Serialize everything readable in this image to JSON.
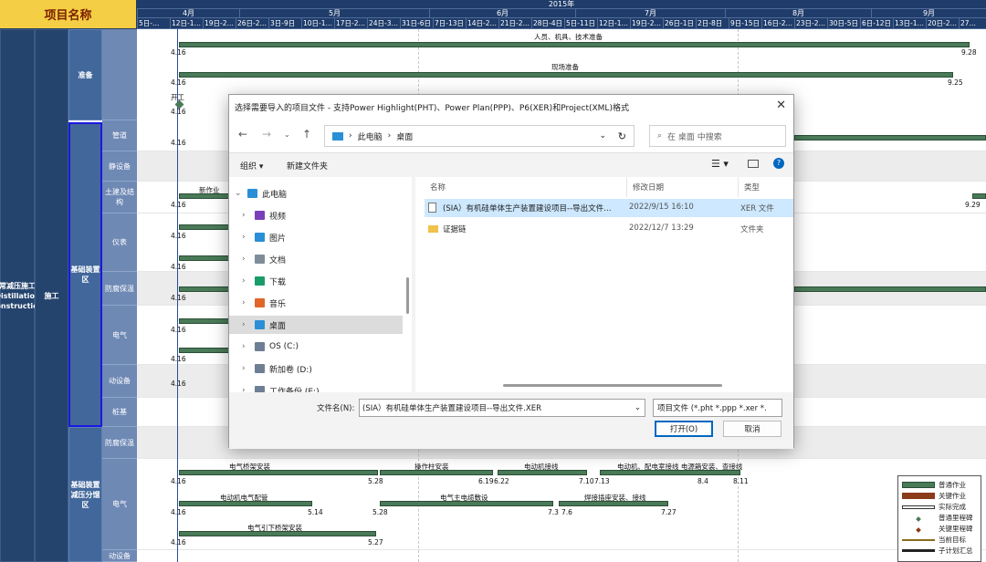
{
  "project_header": "项目名称",
  "timeline": {
    "year": "2015年",
    "months": [
      "4月",
      "5月",
      "6月",
      "7月",
      "8月",
      "9月"
    ],
    "weeks": [
      "5日-…",
      "12日-1…",
      "19日-2…",
      "26日-2…",
      "3日-9日",
      "10日-1…",
      "17日-2…",
      "24日-3…",
      "31日-6日",
      "7日-13日",
      "14日-2…",
      "21日-2…",
      "28日-4日",
      "5日-11日",
      "12日-1…",
      "19日-2…",
      "26日-1日",
      "2日-8日",
      "9日-15日",
      "16日-2…",
      "23日-2…",
      "30日-5日",
      "6日-12日",
      "13日-1…",
      "20日-2…",
      "27…"
    ]
  },
  "tree": {
    "level1": "常减压施工 Distillation construction",
    "level2": "施工",
    "groups": [
      {
        "label": "准备"
      },
      {
        "label": "基础装置区"
      },
      {
        "label": "基础装置减压分馏区"
      }
    ],
    "items": [
      "管道",
      "静设备",
      "土建及结构",
      "仪表",
      "防腐保温",
      "电气",
      "动设备",
      "桩基",
      "防腐保温",
      "电气",
      "动设备"
    ]
  },
  "gantt": {
    "labels": {
      "people": "人员、机具、技术准备",
      "site": "现场准备",
      "start": "开工",
      "newjob": "新作业",
      "cable_tray": "电气桥架安装",
      "column": "操作柱安装",
      "motor_wiring": "电动机接线",
      "motor_dist": "电动机、配电室接线 电源箱安装、查接线",
      "motor_cfg": "电动机电气配管",
      "main_cable": "电气主电缆敷设",
      "weld": "焊接插座安装、接线",
      "cable_lay": "电气引下桥架安装"
    },
    "dates": [
      "4.16",
      "9.28",
      "9.25",
      "9.29",
      "5.28",
      "6.19",
      "6.22",
      "7.10",
      "7.13",
      "8.4",
      "8.11",
      "5.14",
      "5.28",
      "7.3",
      "7.6",
      "7.27",
      "5.27"
    ]
  },
  "dialog": {
    "title": "选择需要导入的项目文件 - 支持Power Highlight(PHT)、Power Plan(PPP)、P6(XER)和Project(XML)格式",
    "breadcrumb": [
      "此电脑",
      "桌面"
    ],
    "search_placeholder": "在 桌面 中搜索",
    "organize": "组织 ▾",
    "new_folder": "新建文件夹",
    "tree": [
      {
        "label": "此电脑",
        "icon": "computer-icon",
        "expanded": true
      },
      {
        "label": "视频",
        "icon": "video-icon"
      },
      {
        "label": "图片",
        "icon": "picture-icon"
      },
      {
        "label": "文档",
        "icon": "document-icon"
      },
      {
        "label": "下载",
        "icon": "download-icon"
      },
      {
        "label": "音乐",
        "icon": "music-icon"
      },
      {
        "label": "桌面",
        "icon": "desktop-icon",
        "selected": true
      },
      {
        "label": "OS (C:)",
        "icon": "drive-icon"
      },
      {
        "label": "新加卷 (D:)",
        "icon": "drive-icon"
      },
      {
        "label": "工作备份 (E:)",
        "icon": "drive-icon"
      }
    ],
    "columns": [
      "名称",
      "修改日期",
      "类型"
    ],
    "files": [
      {
        "name": "(SIA）有机硅单体生产装置建设项目--导出文件…",
        "date": "2022/9/15 16:10",
        "type": "XER 文件",
        "selected": true
      },
      {
        "name": "证据链",
        "date": "2022/12/7 13:29",
        "type": "文件夹"
      }
    ],
    "filename_label": "文件名(N):",
    "filename_value": "(SIA）有机硅单体生产装置建设项目--导出文件.XER",
    "filetype_value": "项目文件 (*.pht *.ppp *.xer *.",
    "open_label": "打开(O)",
    "cancel_label": "取消"
  },
  "legend": [
    "普通作业",
    "关键作业",
    "实际完成",
    "普通里程碑",
    "关键里程碑",
    "当前目标",
    "子计划汇总"
  ],
  "colors": {
    "header_gold": "#f4cf45",
    "timeline_navy": "#1f3c6a",
    "bar_green": "#4a7a58",
    "critical_brown": "#8b3a1a",
    "selection_blue": "#cde8ff"
  }
}
